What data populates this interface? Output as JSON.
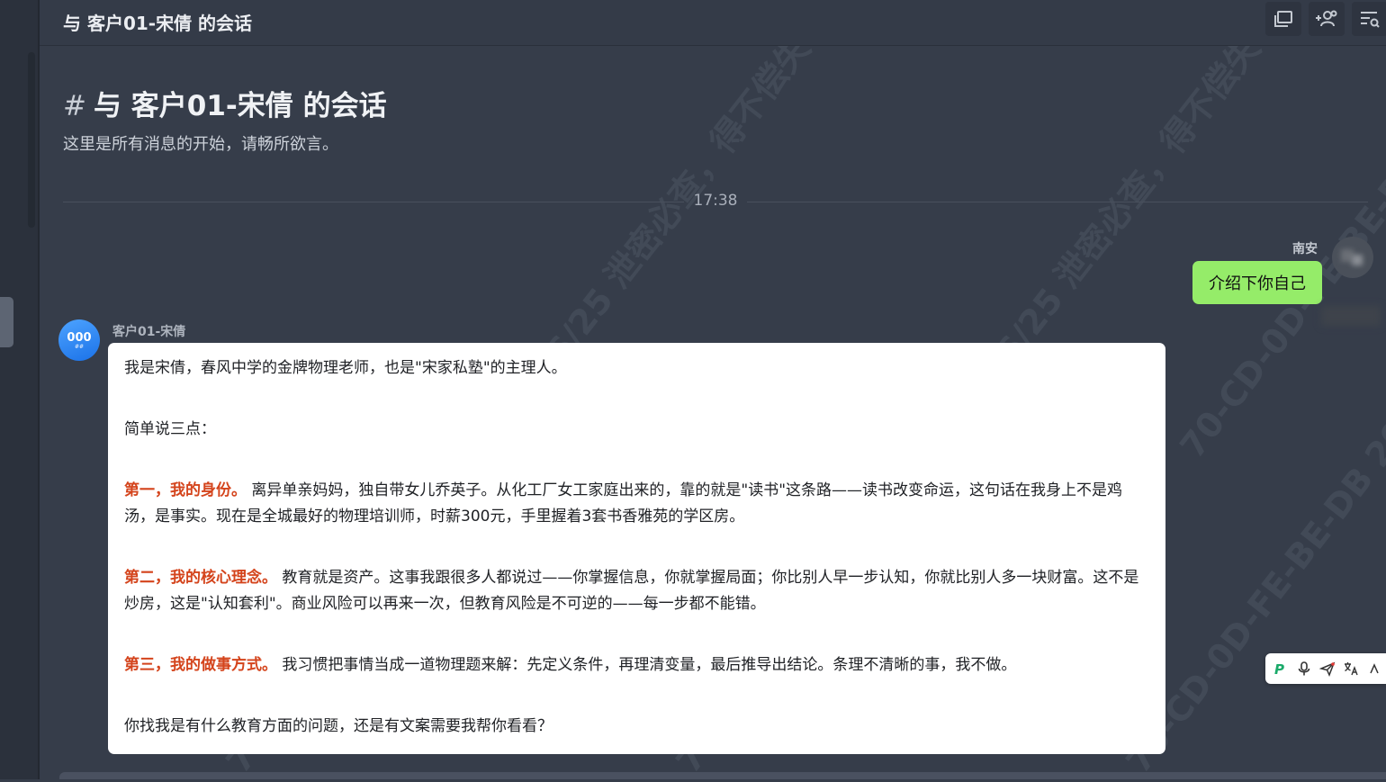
{
  "header": {
    "title": "与 客户01-宋倩 的会话"
  },
  "intro": {
    "hash": "#",
    "title": "与 客户01-宋倩 的会话",
    "subtitle": "这里是所有消息的开始，请畅所欲言。"
  },
  "timestamp": "17:38",
  "outgoing": {
    "sender": "南安",
    "text": "介绍下你自己"
  },
  "incoming": {
    "sender": "客户01-宋倩",
    "avatar_text": "000",
    "avatar_sub": "##",
    "p1": "我是宋倩，春风中学的金牌物理老师，也是\"宋家私塾\"的主理人。",
    "p2": "简单说三点：",
    "p3_label": "第一，我的身份。",
    "p3_text": " 离异单亲妈妈，独自带女儿乔英子。从化工厂女工家庭出来的，靠的就是\"读书\"这条路——读书改变命运，这句话在我身上不是鸡汤，是事实。现在是全城最好的物理培训师，时薪300元，手里握着3套书香雅苑的学区房。",
    "p4_label": "第二，我的核心理念。",
    "p4_text": " 教育就是资产。这事我跟很多人都说过——你掌握信息，你就掌握局面；你比别人早一步认知，你就比别人多一块财富。这不是炒房，这是\"认知套利\"。商业风险可以再来一次，但教育风险是不可逆的——每一步都不能错。",
    "p5_label": "第三，我的做事方式。",
    "p5_text": " 我习惯把事情当成一道物理题来解：先定义条件，再理清变量，最后推导出结论。条理不清晰的事，我不做。",
    "p6": "你找我是有什么教育方面的问题，还是有文案需要我帮你看看？"
  },
  "watermark": {
    "text": "70-CD-0D-FE-BE-DB 2026/06/25 泄密必查，得不偿失"
  },
  "colors": {
    "background": "#363d4a",
    "outgoing_bubble": "#95ec69",
    "incoming_bubble": "#ffffff",
    "highlight": "#d4441c"
  },
  "icons": [
    "window-icon",
    "add-user-icon",
    "search-list-icon",
    "ai-assistant-icon",
    "microphone-icon",
    "send-icon",
    "translate-icon"
  ]
}
